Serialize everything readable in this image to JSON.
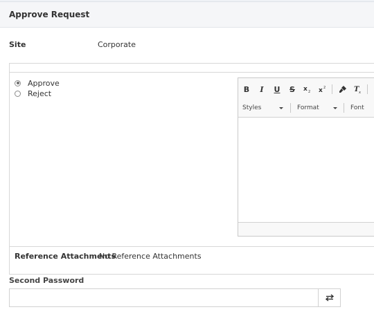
{
  "header": {
    "title": "Approve Request"
  },
  "site": {
    "label": "Site",
    "value": "Corporate"
  },
  "decision": {
    "options": [
      {
        "label": "Approve",
        "selected": true
      },
      {
        "label": "Reject",
        "selected": false
      }
    ]
  },
  "editor": {
    "toolbar": {
      "bold": "B",
      "italic": "I",
      "underline": "U",
      "strike": "S",
      "subscript_icon": "subscript-icon",
      "superscript_icon": "superscript-icon",
      "copy_format_icon": "paint-brush-icon",
      "remove_format_icon": "remove-format-icon",
      "numbered_list_icon": "numbered-list-icon"
    },
    "styles_label": "Styles",
    "format_label": "Format",
    "font_label": "Font"
  },
  "reference": {
    "label": "Reference Attachments",
    "value": "No Reference Attachments"
  },
  "second_password": {
    "label": "Second Password",
    "value": "",
    "toggle_icon": "swap-arrows-icon"
  },
  "colors": {
    "header_bg": "#f5f6f8",
    "border": "#d7d7d7",
    "text": "#333333"
  }
}
